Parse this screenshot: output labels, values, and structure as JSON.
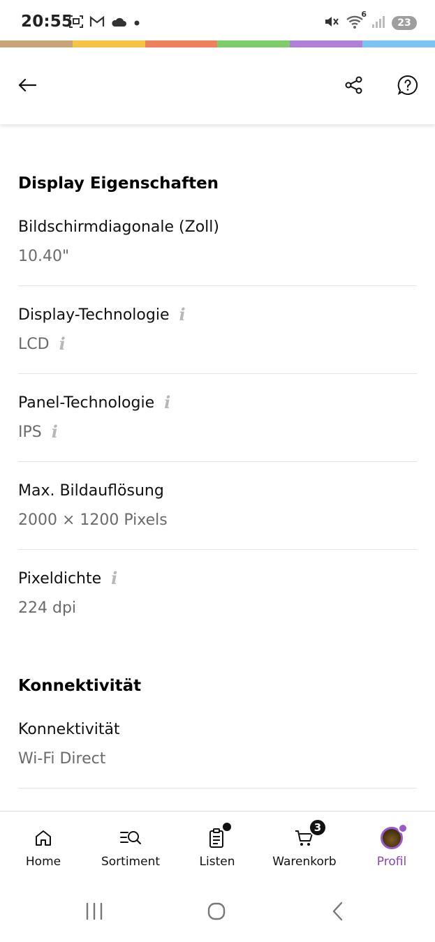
{
  "status_bar": {
    "time": "20:55",
    "battery": "23",
    "left_icons": [
      "screenshot-icon",
      "gmail-icon",
      "cloud-icon",
      "dot-icon"
    ],
    "right_icons": [
      "mute-icon",
      "wifi-icon",
      "signal-icon",
      "battery-icon"
    ],
    "wifi_badge": "6"
  },
  "stripe_colors": [
    "#c8a478",
    "#f6c342",
    "#f07f5b",
    "#7dcd6a",
    "#b07fd8",
    "#7cc3f2"
  ],
  "top_bar": {
    "back_icon": "arrow-left-icon",
    "share_icon": "share-icon",
    "help_icon": "help-circle-icon"
  },
  "sections": {
    "display": {
      "title": "Display Eigenschaften",
      "props": [
        {
          "label": "Bildschirmdiagonale (Zoll)",
          "value": "10.40\""
        },
        {
          "label": "Display-Technologie",
          "value": "LCD"
        },
        {
          "label": "Panel-Technologie",
          "value": "IPS"
        },
        {
          "label": "Max. Bildauflösung",
          "value": "2000 × 1200 Pixels"
        },
        {
          "label": "Pixeldichte",
          "value": "224 dpi"
        }
      ]
    },
    "connectivity": {
      "title": "Konnektivität",
      "props": [
        {
          "label": "Konnektivität",
          "value": "Wi-Fi Direct"
        }
      ]
    }
  },
  "info_glyph": "i",
  "bottom_nav": {
    "items": [
      {
        "label": "Home",
        "icon": "home-icon"
      },
      {
        "label": "Sortiment",
        "icon": "search-list-icon"
      },
      {
        "label": "Listen",
        "icon": "clipboard-icon"
      },
      {
        "label": "Warenkorb",
        "icon": "cart-icon",
        "badge": "3"
      },
      {
        "label": "Profil",
        "icon": "avatar-icon",
        "active": true
      }
    ],
    "active_color": "#8b44b8"
  },
  "system_nav": {
    "icons": [
      "recents-icon",
      "home-button-icon",
      "back-icon"
    ]
  }
}
